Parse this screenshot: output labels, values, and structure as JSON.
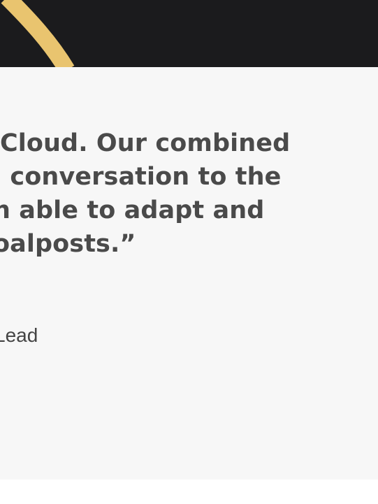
{
  "colors": {
    "page_background": "#ffffff",
    "hero_background": "#1b1b1d",
    "accent_stroke": "#e9c46f",
    "card_background": "#f7f7f7",
    "quote_text": "#4a4a4a",
    "attribution_text": "#444444"
  },
  "quote": {
    "lines": [
      "Cloud. Our combined",
      "l conversation to the",
      "n able to adapt and",
      "oalposts.”"
    ]
  },
  "attribution": {
    "role": "Lead"
  }
}
